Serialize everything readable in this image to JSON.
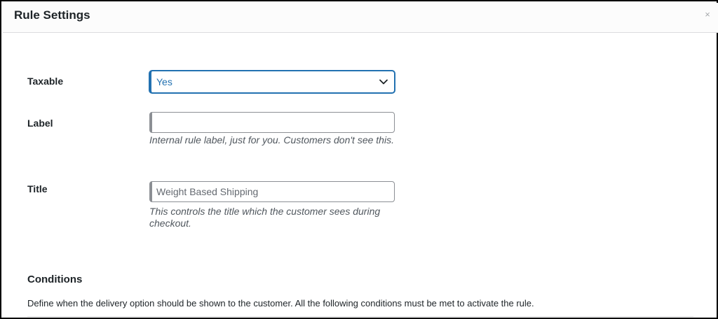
{
  "modal": {
    "title": "Rule Settings",
    "close_symbol": "×"
  },
  "fields": {
    "taxable": {
      "label": "Taxable",
      "selected_value": "Yes"
    },
    "label": {
      "label": "Label",
      "value": "",
      "placeholder": "",
      "help": "Internal rule label, just for you. Customers don't see this."
    },
    "title": {
      "label": "Title",
      "value": "",
      "placeholder": "Weight Based Shipping",
      "help": "This controls the title which the customer sees during checkout."
    }
  },
  "conditions": {
    "heading": "Conditions",
    "description": "Define when the delivery option should be shown to the customer. All the following conditions must be met to activate the rule."
  },
  "colors": {
    "accent": "#2271b1",
    "input_border": "#8c8f94",
    "help_text": "#50575e"
  },
  "icons": {
    "close": "close-icon",
    "dropdown": "chevron-down-icon"
  }
}
